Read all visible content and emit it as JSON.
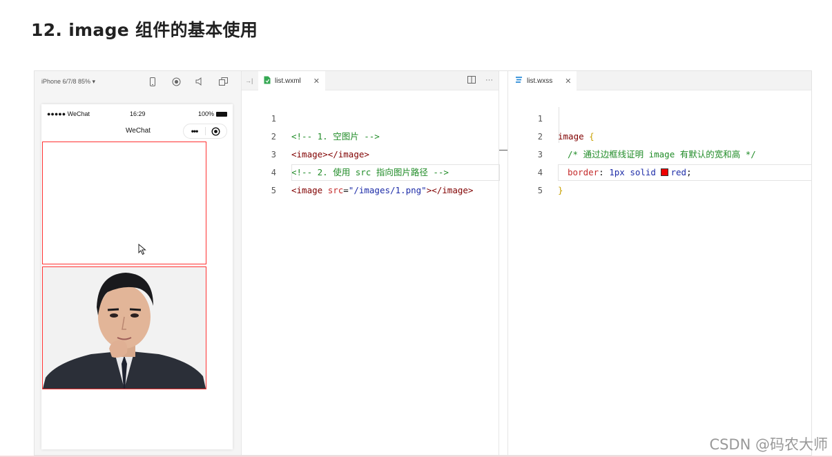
{
  "slide_title": "12. image 组件的基本使用",
  "simulator": {
    "device_label": "iPhone 6/7/8 85% ▾",
    "status": {
      "carrier": "●●●●● WeChat",
      "time": "16:29",
      "battery": "100%"
    },
    "nav_title": "WeChat",
    "capsule_dots": "•••"
  },
  "editor_left": {
    "tab_label": "list.wxml",
    "lines": [
      {
        "n": "1"
      },
      {
        "n": "2"
      },
      {
        "n": "3"
      },
      {
        "n": "4"
      },
      {
        "n": "5"
      }
    ],
    "code": {
      "l1_comment": "<!-- 1. 空图片 -->",
      "l2_open": "<image>",
      "l2_close": "</image>",
      "l3_comment": "<!-- 2. 使用 src 指向图片路径 -->",
      "l4_tag_open": "<image ",
      "l4_attr": "src",
      "l4_eq": "=",
      "l4_value": "\"/images/1.png\"",
      "l4_tail": "></image>"
    }
  },
  "editor_right": {
    "tab_label": "list.wxss",
    "lines": [
      {
        "n": "1"
      },
      {
        "n": "2"
      },
      {
        "n": "3"
      },
      {
        "n": "4"
      },
      {
        "n": "5"
      }
    ],
    "code": {
      "l1_selector": "image ",
      "l1_brace": "{",
      "l2_comment": "/* 通过边框线证明 image 有默认的宽和高 */",
      "l3_prop": "border",
      "l3_colon": ": ",
      "l3_value": "1px solid ",
      "l3_color": "red",
      "l3_semi": ";",
      "l4_brace": "}",
      "swatch_color": "#ee0000"
    }
  },
  "watermark": "CSDN @码农大师",
  "colors": {
    "border_red": "#ff3030",
    "comment_green": "#218c28",
    "tag_maroon": "#800000",
    "string_blue": "#1d2ca8"
  }
}
